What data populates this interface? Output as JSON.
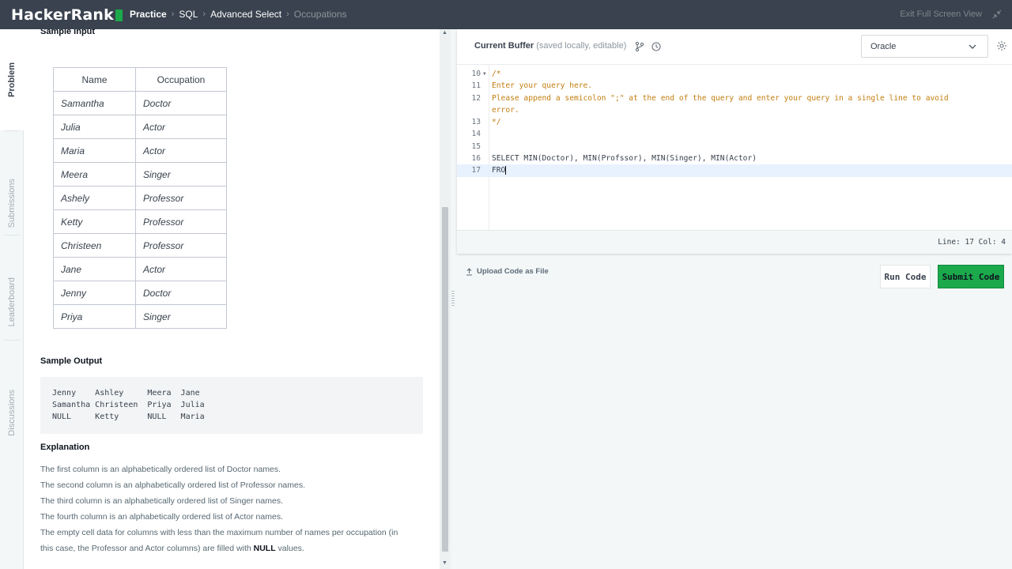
{
  "brand": {
    "name": "HackerRank",
    "accent": "#1ba94c"
  },
  "breadcrumb": [
    "Practice",
    "SQL",
    "Advanced Select",
    "Occupations"
  ],
  "exit_label": "Exit Full Screen View",
  "side_tabs": [
    "Problem",
    "Submissions",
    "Leaderboard",
    "Discussions"
  ],
  "problem": {
    "sample_input_title": "Sample Input",
    "table_headers": [
      "Name",
      "Occupation"
    ],
    "rows": [
      [
        "Samantha",
        "Doctor"
      ],
      [
        "Julia",
        "Actor"
      ],
      [
        "Maria",
        "Actor"
      ],
      [
        "Meera",
        "Singer"
      ],
      [
        "Ashely",
        "Professor"
      ],
      [
        "Ketty",
        "Professor"
      ],
      [
        "Christeen",
        "Professor"
      ],
      [
        "Jane",
        "Actor"
      ],
      [
        "Jenny",
        "Doctor"
      ],
      [
        "Priya",
        "Singer"
      ]
    ],
    "sample_output_title": "Sample Output",
    "sample_output": "Jenny    Ashley     Meera  Jane\nSamantha Christeen  Priya  Julia\nNULL     Ketty      NULL   Maria",
    "explanation_title": "Explanation",
    "explanation": [
      "The first column is an alphabetically ordered list of Doctor names.",
      "The second column is an alphabetically ordered list of Professor names.",
      "The third column is an alphabetically ordered list of Singer names.",
      "The fourth column is an alphabetically ordered list of Actor names.",
      "The empty cell data for columns with less than the maximum number of names per occupation (in",
      "this case, the Professor and Actor columns) are filled with"
    ],
    "null_word": "NULL",
    "values_word": " values."
  },
  "editor": {
    "buffer_title": "Current Buffer",
    "buffer_sub": "(saved locally, editable)",
    "language": "Oracle",
    "lines": [
      {
        "no": "10",
        "text": "/*",
        "kind": "cm",
        "fold": true
      },
      {
        "no": "11",
        "text": "Enter your query here.",
        "kind": "cm"
      },
      {
        "no": "12",
        "text": "Please append a semicolon \";\" at the end of the query and enter your query in a single line to avoid",
        "kind": "cm"
      },
      {
        "no": "",
        "text": "error.",
        "kind": "cm"
      },
      {
        "no": "13",
        "text": "*/",
        "kind": "cm"
      },
      {
        "no": "14",
        "text": "",
        "kind": "kw"
      },
      {
        "no": "15",
        "text": "",
        "kind": "kw"
      },
      {
        "no": "16",
        "text": "SELECT MIN(Doctor), MIN(Profssor), MIN(Singer), MIN(Actor)",
        "kind": "kw"
      },
      {
        "no": "17",
        "text": "FRO",
        "kind": "kw",
        "active": true
      }
    ],
    "status": "Line: 17 Col: 4"
  },
  "actions": {
    "upload": "Upload Code as File",
    "run": "Run Code",
    "submit": "Submit Code"
  }
}
